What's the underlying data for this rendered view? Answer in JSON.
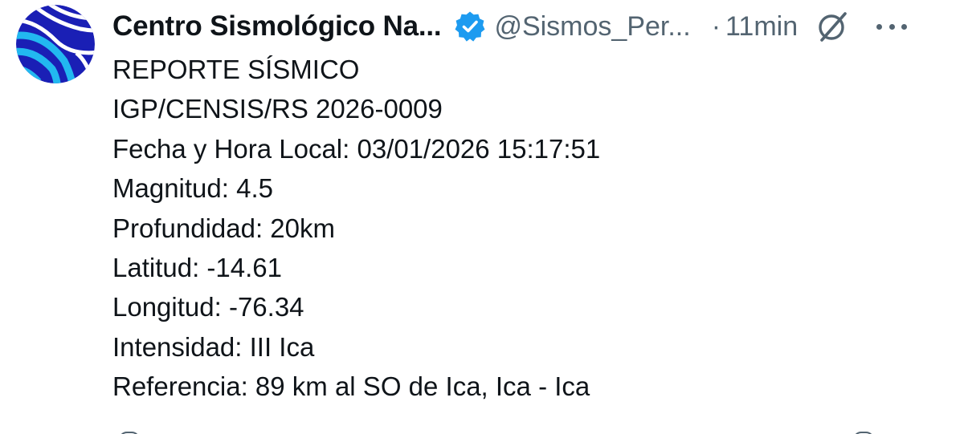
{
  "tweet": {
    "author_name": "Centro Sismológico Na...",
    "handle": "@Sismos_Per...",
    "separator": "·",
    "time": "11min",
    "lines": [
      "REPORTE SÍSMICO",
      "IGP/CENSIS/RS 2026-0009",
      "Fecha y Hora Local: 03/01/2026 15:17:51",
      "Magnitud: 4.5",
      "Profundidad: 20km",
      "Latitud: -14.61",
      "Longitud: -76.34",
      "Intensidad: III Ica",
      "Referencia: 89 km al SO de Ica, Ica - Ica"
    ]
  },
  "icons": {
    "avatar": "logo-avatar-icon",
    "verified": "verified-badge-icon",
    "grok": "grok-icon",
    "more": "more-options-icon"
  },
  "colors": {
    "text_primary": "#0f1419",
    "text_secondary": "#536471",
    "verified_blue": "#1d9bf0",
    "avatar_navy": "#1a1fb5",
    "avatar_cyan": "#22b8f0"
  }
}
